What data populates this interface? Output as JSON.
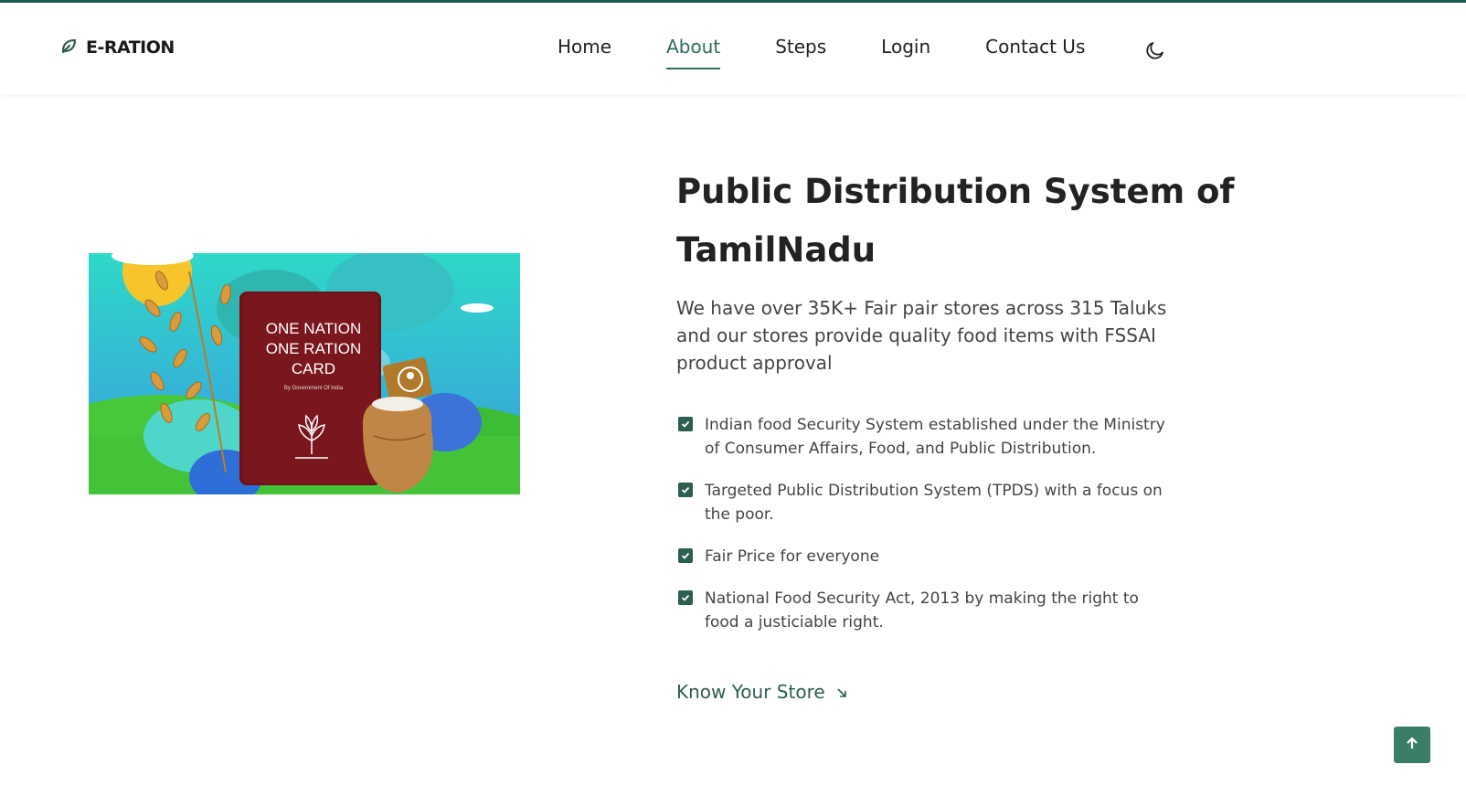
{
  "brand": {
    "name": "E-RATION",
    "icon": "leaf-icon"
  },
  "nav": {
    "items": [
      {
        "label": "Home"
      },
      {
        "label": "About"
      },
      {
        "label": "Steps"
      },
      {
        "label": "Login"
      },
      {
        "label": "Contact Us"
      }
    ],
    "active": "About",
    "theme_icon": "moon-icon"
  },
  "hero": {
    "image": {
      "card_lines": [
        "ONE NATION",
        "ONE RATION",
        "CARD"
      ],
      "card_subtitle": "By Government Of India"
    },
    "title": "Public Distribution System of TamilNadu",
    "intro": "We have over 35K+ Fair pair stores across 315 Taluks and our stores provide quality food items with FSSAI product approval",
    "features": [
      "Indian food Security System established under the Ministry of Consumer Affairs, Food, and Public Distribution.",
      "Targeted Public Distribution System (TPDS) with a focus on the poor.",
      "Fair Price for everyone",
      "National Food Security Act, 2013 by making the right to food a justiciable right."
    ],
    "cta": {
      "label": "Know Your Store",
      "icon": "arrow-down-right-icon"
    }
  },
  "scroll_top": {
    "icon": "arrow-up-icon"
  },
  "colors": {
    "accent": "#2e5e52",
    "top_strip": "#1f5e56",
    "button": "#3b7e68"
  }
}
